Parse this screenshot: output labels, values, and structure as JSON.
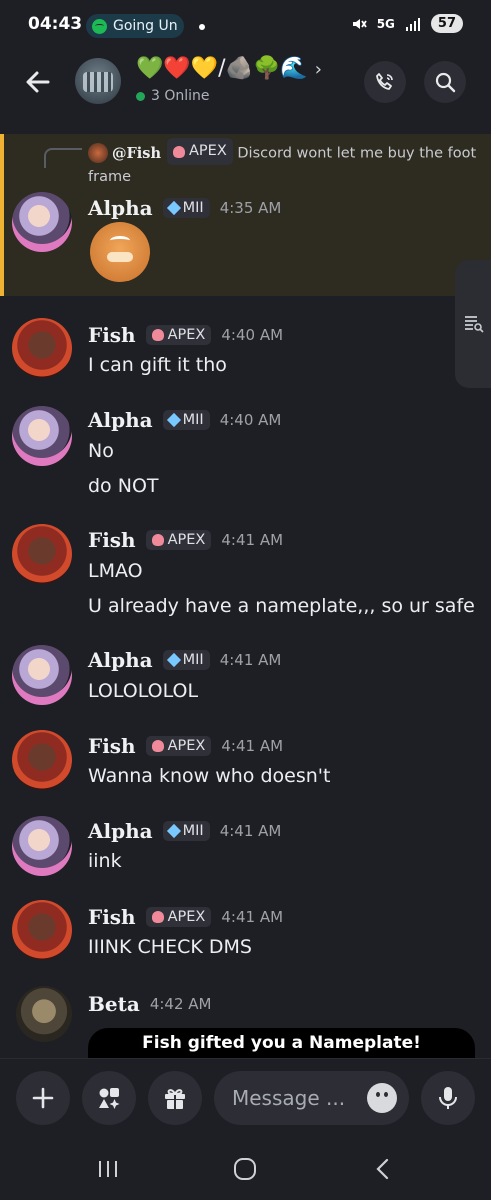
{
  "status_bar": {
    "time": "04:43",
    "now_playing": "Going Un",
    "network": "5G",
    "battery": "57"
  },
  "header": {
    "title": "💚❤️💛/🪨🌳🌊",
    "online": "3 Online"
  },
  "reply": {
    "author": "@Fish",
    "badge": "APEX",
    "text": "Discord wont let me buy the foot frame"
  },
  "messages": [
    {
      "author": "Alpha",
      "badge": "MII",
      "time": "4:35 AM",
      "lines": []
    },
    {
      "author": "Fish",
      "badge": "APEX",
      "time": "4:40 AM",
      "lines": [
        "I can gift it tho"
      ]
    },
    {
      "author": "Alpha",
      "badge": "MII",
      "time": "4:40 AM",
      "lines": [
        "No",
        "do NOT"
      ]
    },
    {
      "author": "Fish",
      "badge": "APEX",
      "time": "4:41 AM",
      "lines": [
        "LMAO",
        "U already have a nameplate,,, so ur safe"
      ]
    },
    {
      "author": "Alpha",
      "badge": "MII",
      "time": "4:41 AM",
      "lines": [
        "LOLOLOLOL"
      ]
    },
    {
      "author": "Fish",
      "badge": "APEX",
      "time": "4:41 AM",
      "lines": [
        "Wanna know who doesn't"
      ]
    },
    {
      "author": "Alpha",
      "badge": "MII",
      "time": "4:41 AM",
      "lines": [
        "iink"
      ]
    },
    {
      "author": "Fish",
      "badge": "APEX",
      "time": "4:41 AM",
      "lines": [
        "IIINK CHECK DMS"
      ]
    },
    {
      "author": "Beta",
      "time": "4:42 AM",
      "lines": []
    }
  ],
  "gift_banner": "Fish gifted you a Nameplate!",
  "composer": {
    "placeholder": "Message ..."
  },
  "icons": [
    "back-icon",
    "call-icon",
    "search-icon",
    "plus-icon",
    "apps-icon",
    "gift-icon",
    "emoji-icon",
    "mic-icon",
    "member-list-icon",
    "recents-icon",
    "home-icon",
    "nav-back-icon"
  ],
  "colors": {
    "background": "#1e1f24",
    "highlight": "#2e2b21",
    "highlight_border": "#f0b232",
    "online": "#23a55a"
  }
}
